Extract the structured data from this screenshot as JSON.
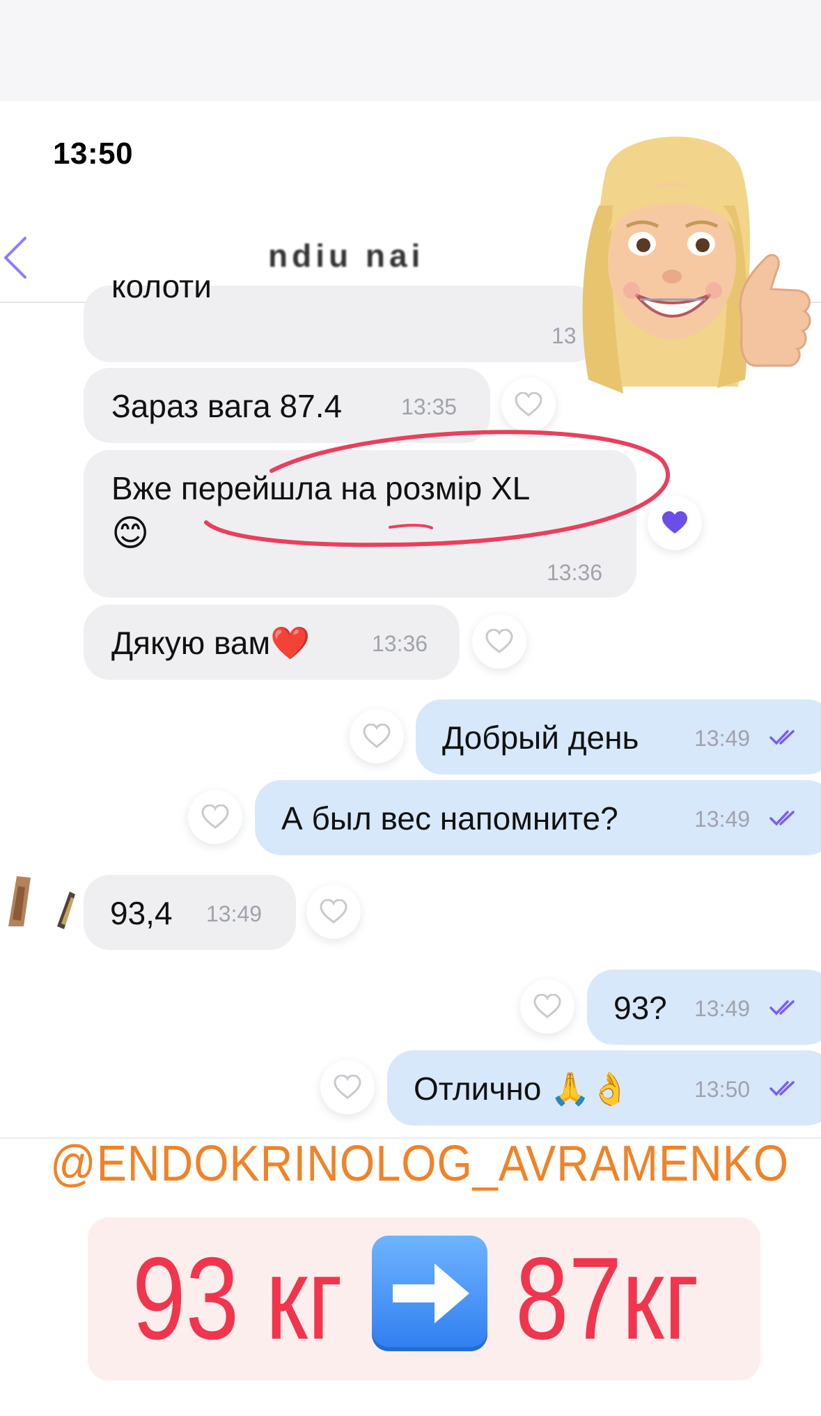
{
  "status_bar": {
    "time": "13:50"
  },
  "header": {
    "title": "ndiu nai"
  },
  "messages": [
    {
      "dir": "in",
      "text": "колоти",
      "time": "13"
    },
    {
      "dir": "in",
      "text": "Зараз вага 87.4",
      "time": "13:35"
    },
    {
      "dir": "in",
      "text": "Вже перейшла на розмір XL",
      "text2": "😊",
      "time": "13:36",
      "reaction": "💜"
    },
    {
      "dir": "in",
      "text": "Дякую вам❤️",
      "time": "13:36"
    },
    {
      "dir": "out",
      "text": "Добрый день",
      "time": "13:49"
    },
    {
      "dir": "out",
      "text": "А был вес напомните?",
      "time": "13:49"
    },
    {
      "dir": "in",
      "text": "93,4",
      "time": "13:49"
    },
    {
      "dir": "out",
      "text": "93?",
      "time": "13:49"
    },
    {
      "dir": "out",
      "text": "Отлично 🙏👌",
      "time": "13:50"
    }
  ],
  "overlay": {
    "username": "@ENDOKRINOLOG_AVRAMENKO",
    "from": "93 кг",
    "arrow": "➡️",
    "to": "87кг"
  },
  "colors": {
    "accent": "#7b5cf5",
    "highlight": "#f0354d",
    "username": "#f08327"
  }
}
